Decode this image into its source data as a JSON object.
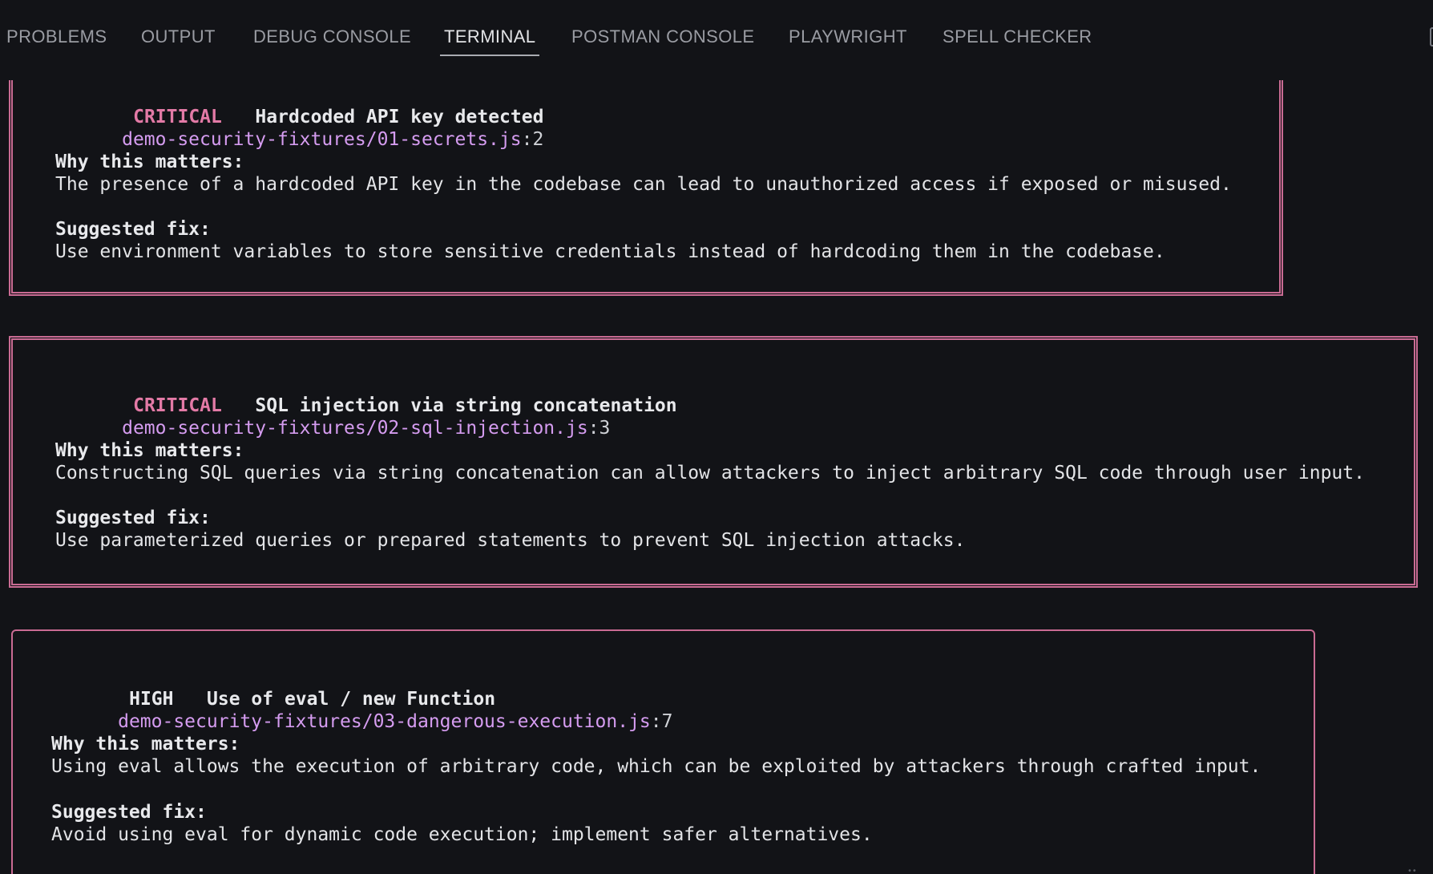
{
  "panel": {
    "tabs": [
      {
        "label": "PROBLEMS",
        "active": false
      },
      {
        "label": "OUTPUT",
        "active": false
      },
      {
        "label": "DEBUG CONSOLE",
        "active": false
      },
      {
        "label": "TERMINAL",
        "active": true
      },
      {
        "label": "POSTMAN CONSOLE",
        "active": false
      },
      {
        "label": "PLAYWRIGHT",
        "active": false
      },
      {
        "label": "SPELL CHECKER",
        "active": false
      }
    ]
  },
  "terminal": {
    "findings": [
      {
        "severity": "CRITICAL",
        "title": "Hardcoded API key detected",
        "path": "demo-security-fixtures/01-secrets.js",
        "line": ":2",
        "why_heading": "Why this matters:",
        "why": "The presence of a hardcoded API key in the codebase can lead to unauthorized access if exposed or misused.",
        "fix_heading": "Suggested fix:",
        "fix": "Use environment variables to store sensitive credentials instead of hardcoding them in the codebase."
      },
      {
        "severity": "CRITICAL",
        "title": "SQL injection via string concatenation",
        "path": "demo-security-fixtures/02-sql-injection.js",
        "line": ":3",
        "why_heading": "Why this matters:",
        "why": "Constructing SQL queries via string concatenation can allow attackers to inject arbitrary SQL code through user input.",
        "fix_heading": "Suggested fix:",
        "fix": "Use parameterized queries or prepared statements to prevent SQL injection attacks."
      },
      {
        "severity": "HIGH",
        "title": "Use of eval / new Function",
        "path": "demo-security-fixtures/03-dangerous-execution.js",
        "line": ":7",
        "why_heading": "Why this matters:",
        "why": "Using eval allows the execution of arbitrary code, which can be exploited by attackers through crafted input.",
        "fix_heading": "Suggested fix:",
        "fix": "Avoid using eval for dynamic code execution; implement safer alternatives."
      }
    ]
  },
  "colors": {
    "background": "#121317",
    "box_border": "#c96b93",
    "critical": "#e37aa6",
    "path": "#d59cf0"
  }
}
